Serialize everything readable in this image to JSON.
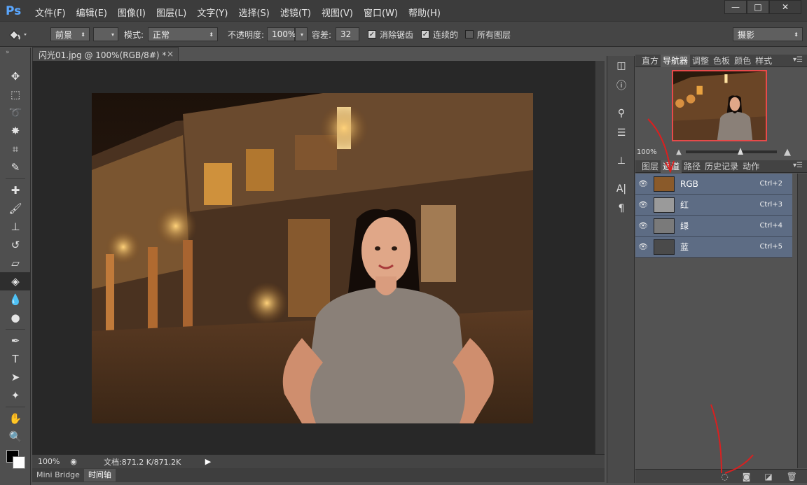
{
  "app": {
    "logo": "Ps"
  },
  "menu": [
    "文件(F)",
    "编辑(E)",
    "图像(I)",
    "图层(L)",
    "文字(Y)",
    "选择(S)",
    "滤镜(T)",
    "视图(V)",
    "窗口(W)",
    "帮助(H)"
  ],
  "window_controls": {
    "minimize": "—",
    "maximize": "□",
    "close": "✕"
  },
  "options": {
    "source_value": "前景",
    "mode_label": "模式:",
    "mode_value": "正常",
    "opacity_label": "不透明度:",
    "opacity_value": "100%",
    "tolerance_label": "容差:",
    "tolerance_value": "32",
    "antialias_label": "消除锯齿",
    "antialias_checked": true,
    "contiguous_label": "连续的",
    "contiguous_checked": true,
    "all_layers_label": "所有图层",
    "all_layers_checked": false,
    "workspace_value": "摄影"
  },
  "document": {
    "tab_title": "闪光01.jpg @ 100%(RGB/8#) *",
    "close_glyph": "×",
    "zoom": "100%",
    "doc_info": "文档:871.2 K/871.2K"
  },
  "bottom_tabs": [
    "Mini Bridge",
    "时间轴"
  ],
  "navigator": {
    "tabs": [
      "直方",
      "导航器",
      "调整",
      "色板",
      "颜色",
      "样式"
    ],
    "active_tab": "导航器",
    "zoom": "100%"
  },
  "channels_panel": {
    "tabs": [
      "图层",
      "通道",
      "路径",
      "历史记录",
      "动作"
    ],
    "active_tab": "通道",
    "channels": [
      {
        "name": "RGB",
        "shortcut": "Ctrl+2",
        "thumb": "#8a5a2a"
      },
      {
        "name": "红",
        "shortcut": "Ctrl+3",
        "thumb": "#9a9a9a"
      },
      {
        "name": "绿",
        "shortcut": "Ctrl+4",
        "thumb": "#7a7a7a"
      },
      {
        "name": "蓝",
        "shortcut": "Ctrl+5",
        "thumb": "#4a4a4a"
      }
    ]
  },
  "colors": {
    "foreground": "#000000",
    "background": "#ffffff",
    "accent": "#e84a4a",
    "channel_row": "#5d6c84"
  }
}
